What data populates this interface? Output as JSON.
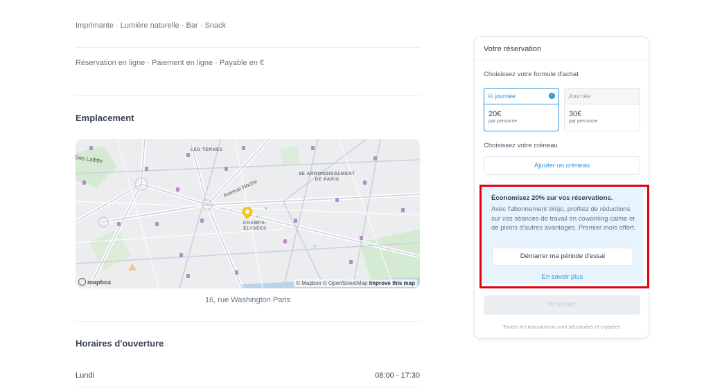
{
  "details": {
    "amenities": "Imprimante · Lumière naturelle · Bar · Snack",
    "booking_info": "Réservation en ligne · Paiement en ligne · Payable en €"
  },
  "location": {
    "title": "Emplacement",
    "address": "16, rue Washington Paris",
    "map": {
      "labels": {
        "ternes": "LES TERNES",
        "arrondissement": "8E ARRONDISSEMENT DE PARIS",
        "champs": "CHAMPS-ÉLYSÉES",
        "hoche": "Avenue Hoche",
        "laffitte": "Des Laffitte"
      },
      "attribution": "© Mapbox © OpenStreetMap",
      "improve_link": "Improve this map",
      "logo": "mapbox"
    }
  },
  "hours": {
    "title": "Horaires d'ouverture",
    "rows": [
      {
        "day": "Lundi",
        "time": "08:00 - 17:30"
      }
    ]
  },
  "reservation": {
    "title": "Votre réservation",
    "formula_label": "Choisissez votre formule d'achat",
    "options": [
      {
        "name": "½ journée",
        "price": "20€",
        "unit": "par personne",
        "selected": true
      },
      {
        "name": "Journée",
        "price": "30€",
        "unit": "par personne",
        "selected": false
      }
    ],
    "slot_label": "Choisissez votre créneau",
    "add_slot": "Ajouter un créneau",
    "promo": {
      "title": "Économisez 20% sur vos réservations.",
      "text": "Avec l'abonnement Wojo, profitez de réductions sur vos séances de travail en coworking calme et de pleins d'autres avantages. Premier mois offert.",
      "trial_button": "Démarrer ma période d'essai",
      "learn_more": "En savoir plus"
    },
    "reserve_button": "Réserver",
    "secure_note": "Toutes les transactions sont sécurisées et cryptées."
  },
  "colors": {
    "accent": "#2f93d9",
    "highlight": "#e0000f",
    "promo_bg": "#e8f4fd"
  }
}
